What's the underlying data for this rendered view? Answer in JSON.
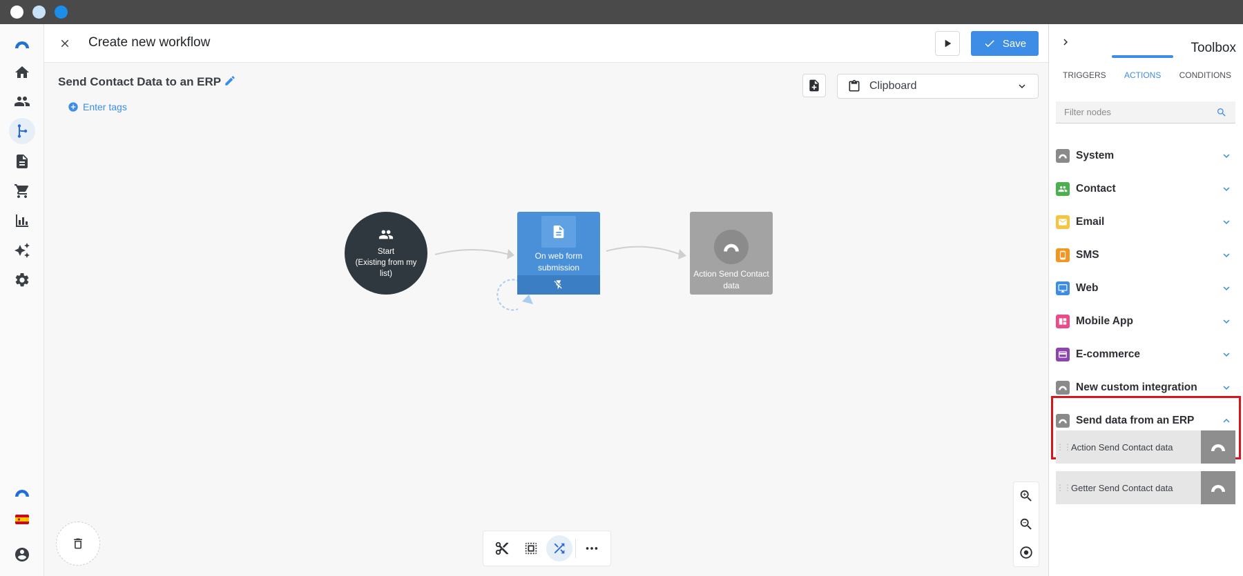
{
  "window": {
    "controls": [
      "close",
      "minimize",
      "maximize"
    ]
  },
  "sidebar": {
    "items": [
      {
        "name": "logo-icon"
      },
      {
        "name": "home-icon"
      },
      {
        "name": "contacts-icon"
      },
      {
        "name": "workflow-icon",
        "active": true
      },
      {
        "name": "document-icon"
      },
      {
        "name": "cart-icon"
      },
      {
        "name": "chart-icon"
      },
      {
        "name": "sparkle-icon"
      },
      {
        "name": "gear-icon"
      },
      {
        "name": "brand-icon"
      },
      {
        "name": "spain-flag-icon"
      },
      {
        "name": "user-icon"
      }
    ]
  },
  "header": {
    "title": "Create new workflow",
    "save_label": "Save"
  },
  "canvas": {
    "workflow_name": "Send Contact Data to an ERP",
    "tags_label": "Enter tags",
    "clipboard_label": "Clipboard",
    "nodes": {
      "start": {
        "title": "Start",
        "subtitle": "(Existing from my list)"
      },
      "web": {
        "label": "On web form submission"
      },
      "action": {
        "label": "Action Send Contact data"
      }
    }
  },
  "toolbox": {
    "title": "Toolbox",
    "tabs": [
      "TRIGGERS",
      "ACTIONS",
      "CONDITIONS"
    ],
    "active_tab": "ACTIONS",
    "filter_placeholder": "Filter nodes",
    "categories": [
      {
        "label": "System",
        "color": "#8a8a8a"
      },
      {
        "label": "Contact",
        "color": "#4caf50"
      },
      {
        "label": "Email",
        "color": "#f5c542"
      },
      {
        "label": "SMS",
        "color": "#f5941e"
      },
      {
        "label": "Web",
        "color": "#3d8ce6"
      },
      {
        "label": "Mobile App",
        "color": "#e94c89"
      },
      {
        "label": "E-commerce",
        "color": "#8e44ad"
      },
      {
        "label": "New custom integration",
        "color": "#8a8a8a"
      },
      {
        "label": "Send data from an ERP",
        "color": "#8a8a8a",
        "expanded": true
      }
    ],
    "sub_items": [
      {
        "label": "Action Send Contact data"
      },
      {
        "label": "Getter Send Contact data"
      }
    ]
  },
  "colors": {
    "accent": "#3d8ce6",
    "highlight": "#d9141b",
    "start_node": "#30383f"
  }
}
